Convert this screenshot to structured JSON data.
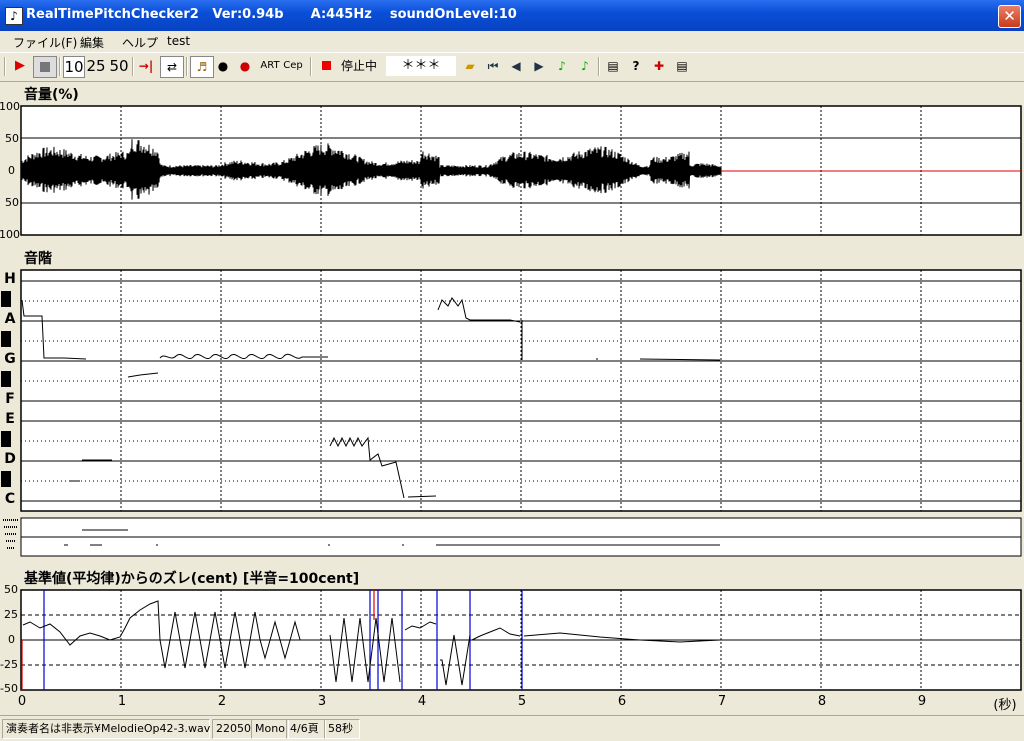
{
  "window": {
    "title": "RealTimePitchChecker2   Ver:0.94b      A:445Hz    soundOnLevel:10",
    "app_icon": "treble-clef-icon",
    "close_label": "✕"
  },
  "menu": [
    "ファイル(F)",
    "編集",
    "ヘルプ",
    "test"
  ],
  "toolbar": {
    "speed1": "10",
    "speed2": "25",
    "speed3": "50",
    "art_label": "ART",
    "cep_label": "Cep",
    "status": "停止中",
    "time_display": "＊＊＊"
  },
  "volume_panel": {
    "title": "音量(%)",
    "yticks": [
      "100",
      "50",
      "0",
      "50",
      "100"
    ]
  },
  "scale_panel": {
    "title": "音階",
    "notes": [
      "H",
      "A",
      "G",
      "F",
      "E",
      "D",
      "C"
    ]
  },
  "cent_panel": {
    "title": "基準値(平均律)からのズレ(cent) [半音=100cent]",
    "yticks": [
      "50",
      "25",
      "0",
      "-25",
      "-50"
    ]
  },
  "x_axis": {
    "ticks": [
      "0",
      "1",
      "2",
      "3",
      "4",
      "5",
      "6",
      "7",
      "8",
      "9"
    ],
    "unit": "(秒)"
  },
  "status": {
    "file": "演奏者名は非表示¥MelodieOp42-3.wav",
    "rate": "22050",
    "channels": "Mono",
    "page": "4/6頁",
    "duration": "58秒"
  },
  "colors": {
    "waveform": "#000000",
    "zero_line": "#ff0000",
    "marker": "#0000ff"
  }
}
